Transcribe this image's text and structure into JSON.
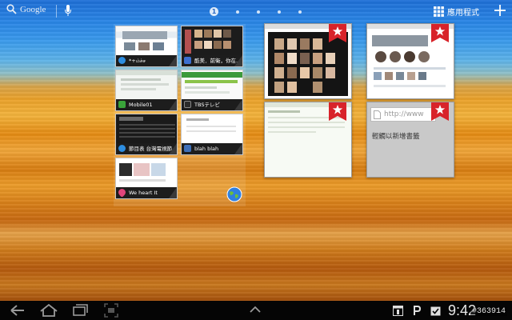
{
  "topbar": {
    "search_label": "Google",
    "current_page": "1",
    "apps_label": "應用程式"
  },
  "bookmarks_widget": {
    "tiles": [
      {
        "caption": "*+ம்ச்ச",
        "fav_color": "#2d8de0"
      },
      {
        "caption": "酷美．前衛，你在...",
        "fav_color": "#3c6fd0"
      },
      {
        "caption": "Mobile01",
        "fav_color": "#3aa33a"
      },
      {
        "caption": "TBSテレビ",
        "fav_color": "#2b2b2b"
      },
      {
        "caption": "節目表 台灣電視節...",
        "fav_color": "#2d8de0"
      },
      {
        "caption": "blah blah",
        "fav_color": "#3e6fb8"
      },
      {
        "caption": "We heart It",
        "fav_color": "#e0457b"
      }
    ]
  },
  "tab_cards": [
    {
      "type": "page"
    },
    {
      "type": "page"
    },
    {
      "type": "page"
    },
    {
      "type": "new_bookmark",
      "url_hint": "http://www",
      "text": "輕觸以新增書籤"
    }
  ],
  "navbar": {
    "clock": "9:42",
    "watermark": "#363914"
  },
  "colors": {
    "ribbon": "#d8232a",
    "navbar": "#050505"
  }
}
